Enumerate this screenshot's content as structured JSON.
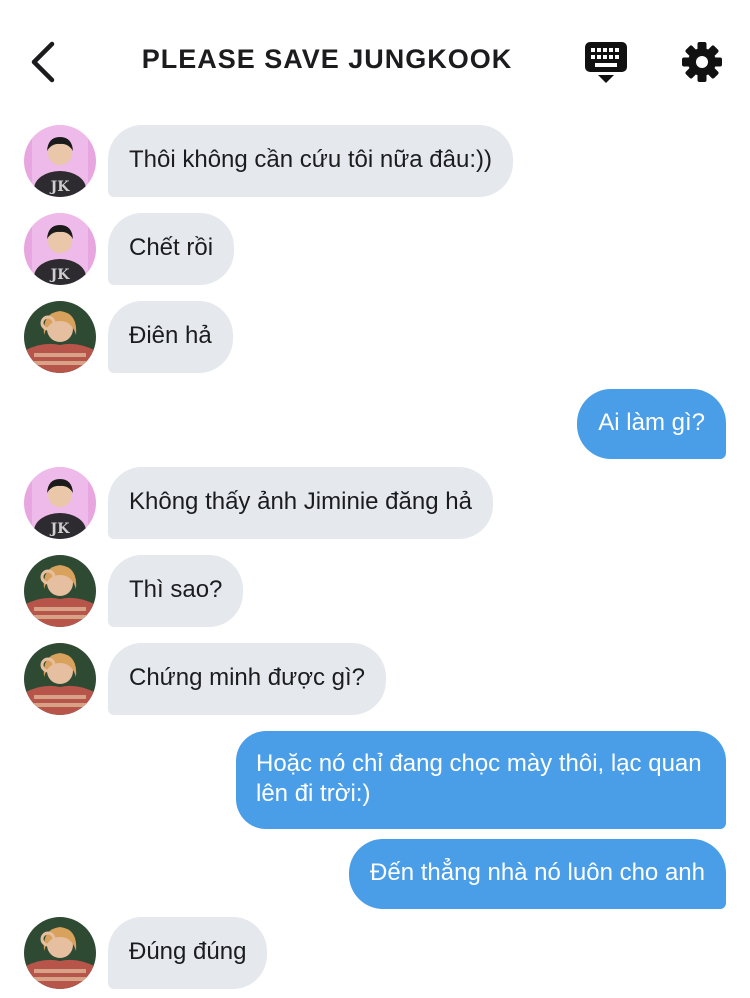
{
  "header": {
    "title": "PLEASE SAVE JUNGKOOK",
    "back_icon": "chevron-left-icon",
    "keyboard_icon": "keyboard-icon",
    "settings_icon": "gear-icon"
  },
  "colors": {
    "incoming_bubble": "#e5e9ee",
    "outgoing_bubble": "#4a9ee8",
    "avatar_a_bg": "#e8a6e0",
    "avatar_b_bg": "#2f4a33"
  },
  "messages": [
    {
      "direction": "incoming",
      "sender": "avatar-a",
      "text": "Thôi không cần cứu tôi nữa đâu:))"
    },
    {
      "direction": "incoming",
      "sender": "avatar-a",
      "text": "Chết rồi"
    },
    {
      "direction": "incoming",
      "sender": "avatar-b",
      "text": "Điên hả"
    },
    {
      "direction": "outgoing",
      "text": "Ai làm gì?"
    },
    {
      "direction": "incoming",
      "sender": "avatar-a",
      "text": "Không thấy ảnh Jiminie đăng hả"
    },
    {
      "direction": "incoming",
      "sender": "avatar-b",
      "text": "Thì sao?"
    },
    {
      "direction": "incoming",
      "sender": "avatar-b",
      "text": "Chứng minh được gì?"
    },
    {
      "direction": "outgoing",
      "text": "Hoặc nó chỉ đang chọc mày thôi, lạc quan lên đi trời:)"
    },
    {
      "direction": "outgoing",
      "text": "Đến thẳng nhà nó luôn cho anh"
    },
    {
      "direction": "incoming",
      "sender": "avatar-b",
      "text": "Đúng đúng"
    }
  ]
}
